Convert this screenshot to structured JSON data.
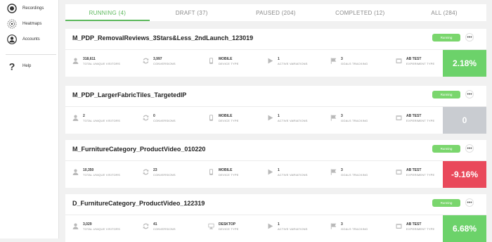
{
  "sidebar": {
    "items": [
      {
        "label": "Recordings",
        "icon": "recordings-icon"
      },
      {
        "label": "Heatmaps",
        "icon": "heatmaps-icon"
      },
      {
        "label": "Accounts",
        "icon": "accounts-icon"
      },
      {
        "label": "Help",
        "icon": "help-icon"
      }
    ]
  },
  "tabs": [
    {
      "label": "RUNNING (4)",
      "active": true
    },
    {
      "label": "DRAFT (37)",
      "active": false
    },
    {
      "label": "PAUSED (204)",
      "active": false
    },
    {
      "label": "COMPLETED (12)",
      "active": false
    },
    {
      "label": "ALL (284)",
      "active": false
    }
  ],
  "colors": {
    "accent": "#5cb85c",
    "positive": "#6cd26a",
    "neutral": "#c9ccd1",
    "negative": "#e9495b"
  },
  "experiments": [
    {
      "title": "M_PDP_RemovalReviews_3Stars&Less_2ndLaunch_123019",
      "status": "Running",
      "visitors": "318,611",
      "visitors_label": "TOTAL UNIQUE VISITORS",
      "conversions": "3,997",
      "conversions_label": "CONVERSIONS",
      "device": "MOBILE",
      "device_label": "DEVICE TYPE",
      "variations": "1",
      "variations_label": "ACTIVE VARIATIONS",
      "goals": "3",
      "goals_label": "GOALS TRACKING",
      "type": "AB TEST",
      "type_label": "EXPERIMENT TYPE",
      "result": "2.18%",
      "result_tone": "positive"
    },
    {
      "title": "M_PDP_LargerFabricTiles_TargetedIP",
      "status": "Running",
      "visitors": "2",
      "visitors_label": "TOTAL UNIQUE VISITORS",
      "conversions": "0",
      "conversions_label": "CONVERSIONS",
      "device": "MOBILE",
      "device_label": "DEVICE TYPE",
      "variations": "1",
      "variations_label": "ACTIVE VARIATIONS",
      "goals": "3",
      "goals_label": "GOALS TRACKING",
      "type": "AB TEST",
      "type_label": "EXPERIMENT TYPE",
      "result": "0",
      "result_tone": "neutral"
    },
    {
      "title": "M_FurnitureCategory_ProductVideo_010220",
      "status": "Running",
      "visitors": "10,350",
      "visitors_label": "TOTAL UNIQUE VISITORS",
      "conversions": "23",
      "conversions_label": "CONVERSIONS",
      "device": "MOBILE",
      "device_label": "DEVICE TYPE",
      "variations": "1",
      "variations_label": "ACTIVE VARIATIONS",
      "goals": "3",
      "goals_label": "GOALS TRACKING",
      "type": "AB TEST",
      "type_label": "EXPERIMENT TYPE",
      "result": "-9.16%",
      "result_tone": "negative"
    },
    {
      "title": "D_FurnitureCategory_ProductVideo_122319",
      "status": "Running",
      "visitors": "3,029",
      "visitors_label": "TOTAL UNIQUE VISITORS",
      "conversions": "41",
      "conversions_label": "CONVERSIONS",
      "device": "DESKTOP",
      "device_label": "DEVICE TYPE",
      "variations": "1",
      "variations_label": "ACTIVE VARIATIONS",
      "goals": "3",
      "goals_label": "GOALS TRACKING",
      "type": "AB TEST",
      "type_label": "EXPERIMENT TYPE",
      "result": "6.68%",
      "result_tone": "positive"
    }
  ]
}
